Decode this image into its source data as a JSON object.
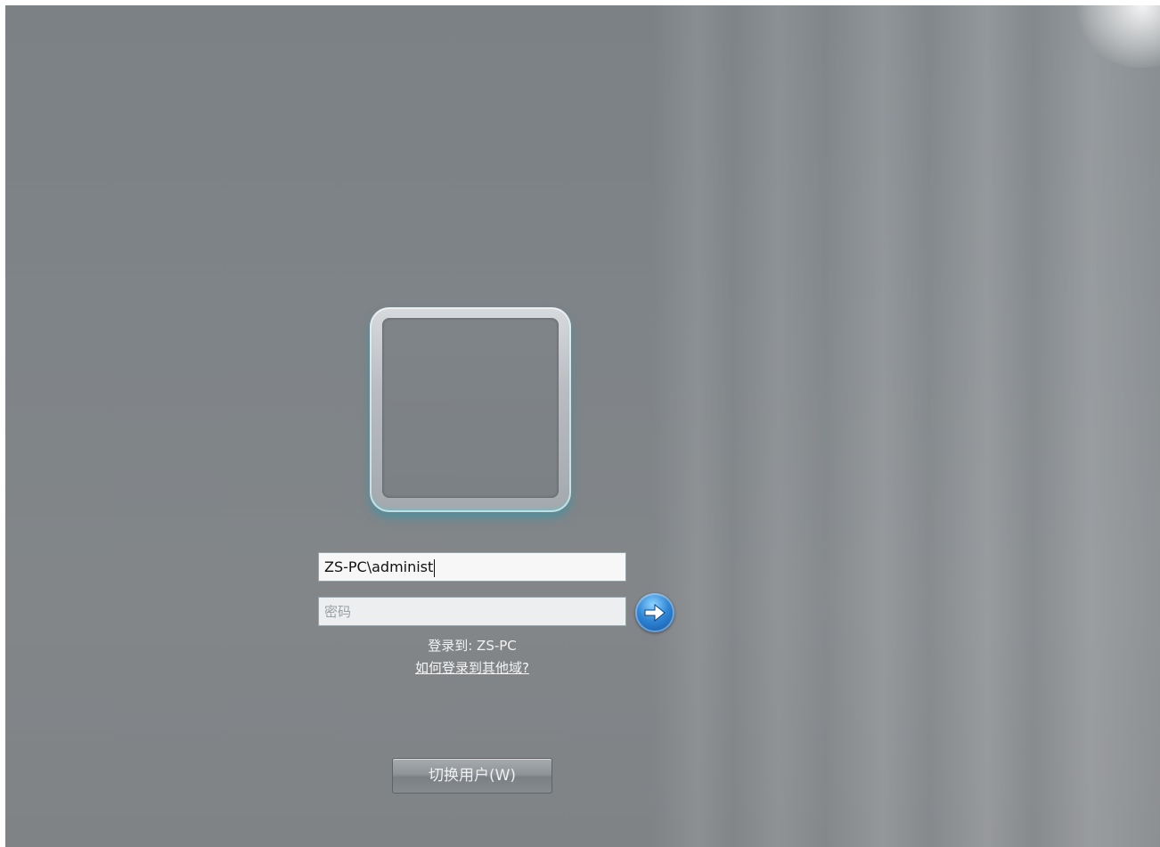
{
  "login": {
    "username_value": "ZS-PC\\administ",
    "password_placeholder": "密码",
    "login_to_text": "登录到: ZS-PC",
    "other_domain_link": "如何登录到其他域?",
    "submit_icon": "arrow-right-icon",
    "switch_user_label": "切换用户(W)"
  },
  "colors": {
    "background": "#7f8488",
    "accent": "#2f86d6"
  }
}
